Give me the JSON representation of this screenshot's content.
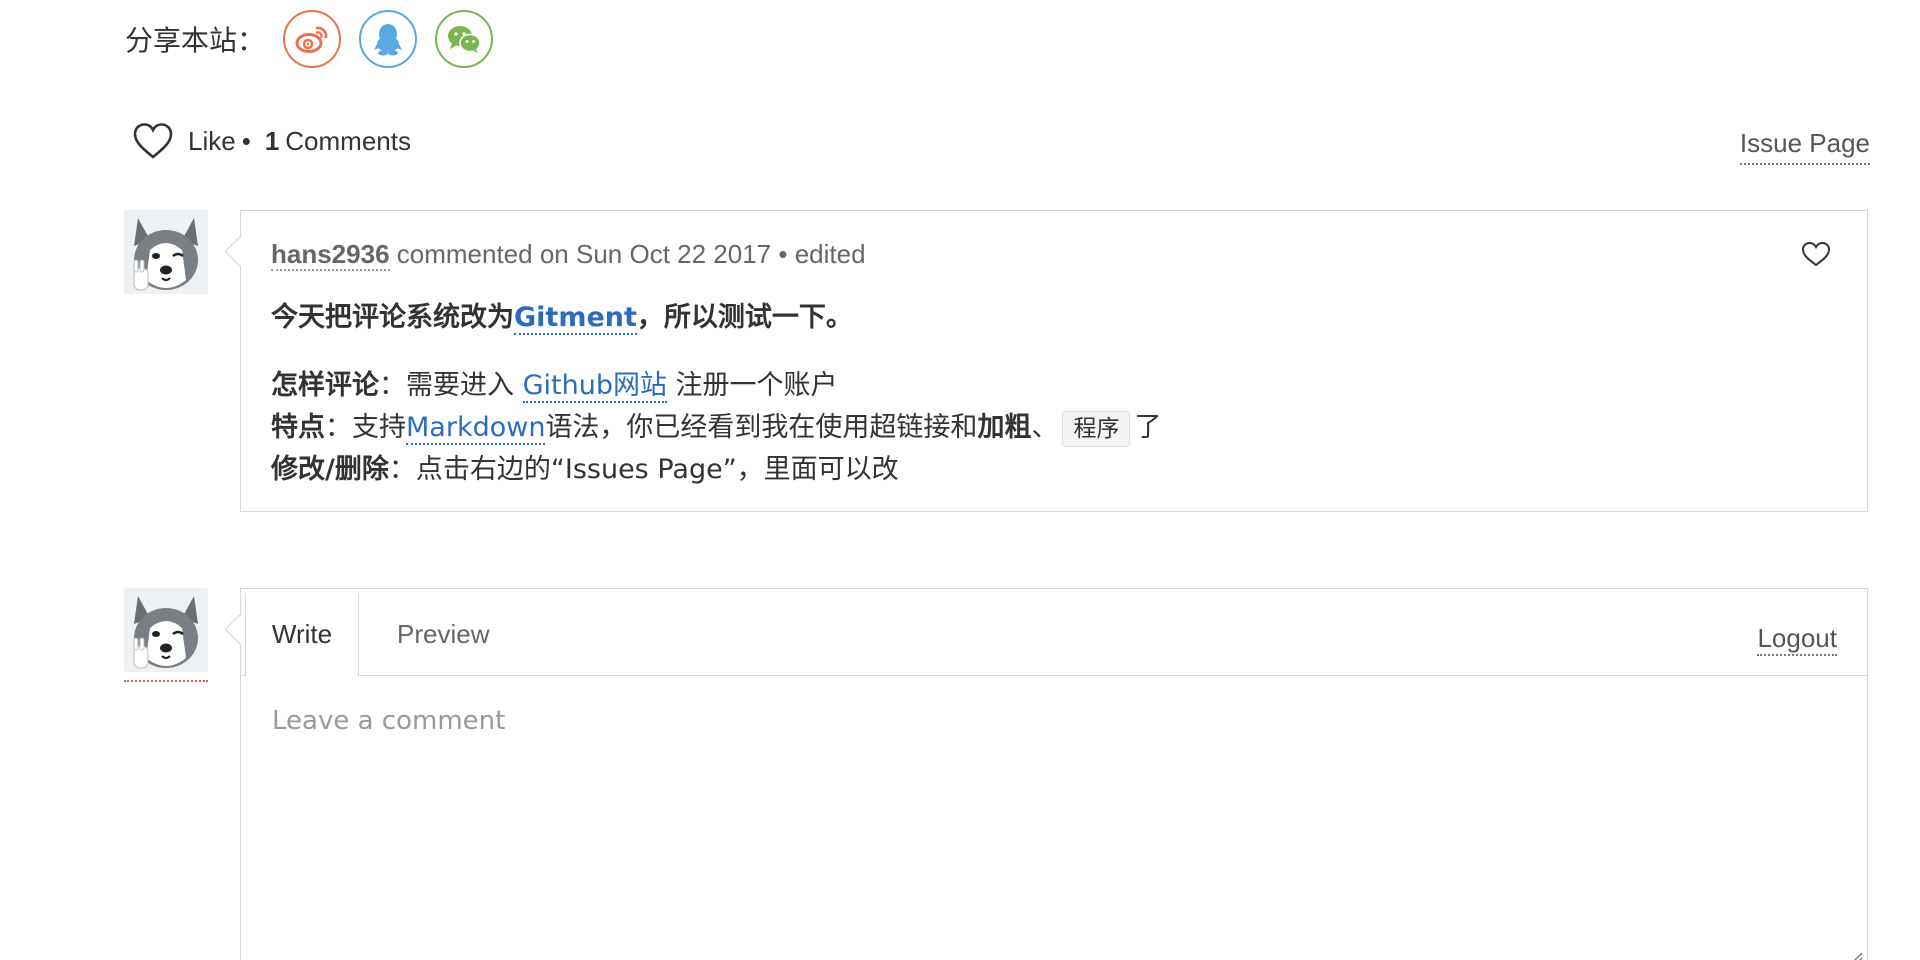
{
  "share": {
    "label": "分享本站：",
    "buttons": [
      {
        "name": "weibo",
        "icon": "weibo-icon",
        "color": "#e8734a"
      },
      {
        "name": "qq",
        "icon": "qq-icon",
        "color": "#57a8e3"
      },
      {
        "name": "wechat",
        "icon": "wechat-icon",
        "color": "#7ab54e"
      }
    ]
  },
  "meta": {
    "like_label": "Like",
    "separator": "•",
    "comment_count": "1",
    "comments_label": "Comments",
    "issue_page_label": "Issue Page"
  },
  "comment": {
    "user": "hans2936",
    "action": "commented on",
    "date": "Sun Oct 22 2017",
    "separator": "•",
    "edited": "edited",
    "intro_prefix": "今天把评论系统改为",
    "intro_link": "Gitment",
    "intro_suffix": "，所以测试一下。",
    "line1_label": "怎样评论",
    "line1_colon": "：",
    "line1_text_a": "需要进入 ",
    "line1_link": "Github网站",
    "line1_text_b": " 注册一个账户",
    "line2_label": "特点",
    "line2_colon": "：",
    "line2_text_a": "支持",
    "line2_link": "Markdown",
    "line2_text_b": "语法，你已经看到我在使用超链接和",
    "line2_bold": "加粗",
    "line2_sep": "、",
    "line2_code": "程序",
    "line2_text_c": "了",
    "line3_label": "修改/删除",
    "line3_colon": "：",
    "line3_text": "点击右边的“Issues Page”，里面可以改"
  },
  "editor": {
    "tab_write": "Write",
    "tab_preview": "Preview",
    "logout_label": "Logout",
    "placeholder": "Leave a comment",
    "value": ""
  },
  "colors": {
    "link": "#2b6cbf",
    "border": "#cfd8dc",
    "weibo": "#e8734a",
    "qq": "#57a8e3",
    "wechat": "#7ab54e",
    "user_underline": "#e05a4b"
  }
}
